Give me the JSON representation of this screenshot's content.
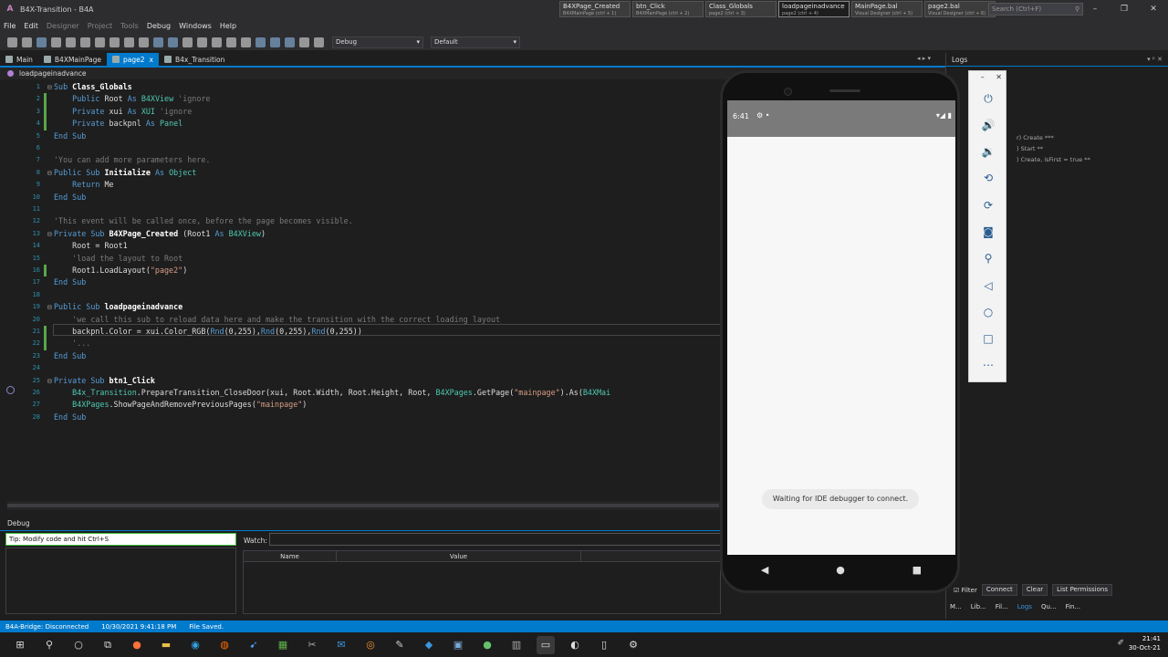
{
  "window": {
    "title": "B4X-Transition - B4A",
    "controls": [
      "–",
      "❐",
      "✕"
    ]
  },
  "quick_tabs": [
    {
      "name": "B4XPage_Created",
      "sub": "B4XMainPage  (ctrl + 1)",
      "active": false
    },
    {
      "name": "btn_Click",
      "sub": "B4XMainPage  (ctrl + 2)",
      "active": false
    },
    {
      "name": "Class_Globals",
      "sub": "page2  (ctrl + 3)",
      "active": false
    },
    {
      "name": "loadpageinadvance",
      "sub": "page2  (ctrl + 4)",
      "active": true
    },
    {
      "name": "MainPage.bal",
      "sub": "Visual Designer  (ctrl + 5)",
      "active": false
    },
    {
      "name": "page2.bal",
      "sub": "Visual Designer  (ctrl + 6)",
      "active": false
    }
  ],
  "search": {
    "placeholder": "Search (Ctrl+F)"
  },
  "menu": [
    "File",
    "Edit",
    "Designer",
    "Project",
    "Tools",
    "Debug",
    "Windows",
    "Help"
  ],
  "toolbar": {
    "build_config": "Debug",
    "build_target": "Default"
  },
  "doc_tabs": [
    {
      "label": "Main",
      "active": false
    },
    {
      "label": "B4XMainPage",
      "active": false
    },
    {
      "label": "page2",
      "active": true,
      "close": "x"
    },
    {
      "label": "B4x_Transition",
      "active": false
    }
  ],
  "breadcrumb": "loadpageinadvance",
  "code": [
    {
      "n": "1",
      "fold": "⊟",
      "tokens": [
        [
          "kw",
          "Sub "
        ],
        [
          "bd",
          "Class_Globals"
        ]
      ]
    },
    {
      "n": "2",
      "tokens": [
        [
          "pl",
          "    "
        ],
        [
          "kw",
          "Public "
        ],
        [
          "pl",
          "Root "
        ],
        [
          "kw",
          "As "
        ],
        [
          "ty",
          "B4XView "
        ],
        [
          "cm",
          "'ignore"
        ]
      ]
    },
    {
      "n": "3",
      "tokens": [
        [
          "pl",
          "    "
        ],
        [
          "kw",
          "Private "
        ],
        [
          "pl",
          "xui "
        ],
        [
          "kw",
          "As "
        ],
        [
          "ty",
          "XUI "
        ],
        [
          "cm",
          "'ignore"
        ]
      ]
    },
    {
      "n": "4",
      "tokens": [
        [
          "pl",
          "    "
        ],
        [
          "kw",
          "Private "
        ],
        [
          "pl",
          "backpnl "
        ],
        [
          "kw",
          "As "
        ],
        [
          "ty",
          "Panel"
        ]
      ]
    },
    {
      "n": "5",
      "tokens": [
        [
          "kw",
          "End Sub"
        ]
      ]
    },
    {
      "n": "6",
      "tokens": []
    },
    {
      "n": "7",
      "tokens": [
        [
          "cm",
          "'You can add more parameters here."
        ]
      ]
    },
    {
      "n": "8",
      "fold": "⊟",
      "tokens": [
        [
          "kw",
          "Public Sub "
        ],
        [
          "bd",
          "Initialize "
        ],
        [
          "kw",
          "As "
        ],
        [
          "ty",
          "Object"
        ]
      ]
    },
    {
      "n": "9",
      "tokens": [
        [
          "pl",
          "    "
        ],
        [
          "kw",
          "Return "
        ],
        [
          "pl",
          "Me"
        ]
      ]
    },
    {
      "n": "10",
      "tokens": [
        [
          "kw",
          "End Sub"
        ]
      ]
    },
    {
      "n": "11",
      "tokens": []
    },
    {
      "n": "12",
      "tokens": [
        [
          "cm",
          "'This event will be called once, before the page becomes visible."
        ]
      ]
    },
    {
      "n": "13",
      "fold": "⊟",
      "tokens": [
        [
          "kw",
          "Private Sub "
        ],
        [
          "bd",
          "B4XPage_Created "
        ],
        [
          "pl",
          "(Root1 "
        ],
        [
          "kw",
          "As "
        ],
        [
          "ty",
          "B4XView"
        ],
        [
          "pl",
          ")"
        ]
      ]
    },
    {
      "n": "14",
      "tokens": [
        [
          "pl",
          "    Root = Root1"
        ]
      ]
    },
    {
      "n": "15",
      "tokens": [
        [
          "pl",
          "    "
        ],
        [
          "cm",
          "'load the layout to Root"
        ]
      ]
    },
    {
      "n": "16",
      "tokens": [
        [
          "pl",
          "    Root1.LoadLayout("
        ],
        [
          "str",
          "\"page2\""
        ],
        [
          "pl",
          ")"
        ]
      ]
    },
    {
      "n": "17",
      "tokens": [
        [
          "kw",
          "End Sub"
        ]
      ]
    },
    {
      "n": "18",
      "tokens": []
    },
    {
      "n": "19",
      "fold": "⊟",
      "tokens": [
        [
          "kw",
          "Public Sub "
        ],
        [
          "bd",
          "loadpageinadvance"
        ]
      ]
    },
    {
      "n": "20",
      "tokens": [
        [
          "pl",
          "    "
        ],
        [
          "cm",
          "'we call this sub to reload data here and make the transition with the correct loading layout"
        ]
      ]
    },
    {
      "n": "21",
      "tokens": [
        [
          "pl",
          "    backpnl.Color = xui.Color_RGB("
        ],
        [
          "kw",
          "Rnd"
        ],
        [
          "pl",
          "(0,255),"
        ],
        [
          "kw",
          "Rnd"
        ],
        [
          "pl",
          "(0,255),"
        ],
        [
          "kw",
          "Rnd"
        ],
        [
          "pl",
          "(0,255))"
        ]
      ]
    },
    {
      "n": "22",
      "tokens": [
        [
          "pl",
          "    "
        ],
        [
          "cm",
          "'..."
        ]
      ]
    },
    {
      "n": "23",
      "tokens": [
        [
          "kw",
          "End Sub"
        ]
      ]
    },
    {
      "n": "24",
      "tokens": []
    },
    {
      "n": "25",
      "fold": "⊟",
      "tokens": [
        [
          "kw",
          "Private Sub "
        ],
        [
          "bd",
          "btn1_Click"
        ]
      ]
    },
    {
      "n": "26",
      "tokens": [
        [
          "pl",
          "    "
        ],
        [
          "ty",
          "B4x_Transition"
        ],
        [
          "pl",
          ".PrepareTransition_CloseDoor(xui, Root.Width, Root.Height, Root, "
        ],
        [
          "ty",
          "B4XPages"
        ],
        [
          "pl",
          ".GetPage("
        ],
        [
          "str",
          "\"mainpage\""
        ],
        [
          "pl",
          ").As("
        ],
        [
          "ty",
          "B4XMai"
        ]
      ]
    },
    {
      "n": "27",
      "tokens": [
        [
          "pl",
          "    "
        ],
        [
          "ty",
          "B4XPages"
        ],
        [
          "pl",
          ".ShowPageAndRemovePreviousPages("
        ],
        [
          "str",
          "\"mainpage\""
        ],
        [
          "pl",
          ")"
        ]
      ]
    },
    {
      "n": "28",
      "tokens": [
        [
          "kw",
          "End Sub"
        ]
      ]
    }
  ],
  "debug_panel": {
    "title": "Debug",
    "tip": "Tip: Modify code and hit Ctrl+S",
    "watch_label": "Watch:",
    "col_name": "Name",
    "col_value": "Value"
  },
  "logs_panel": {
    "title": "Logs",
    "header_icons": "▾ ᵖ ✕",
    "lines": [
      "r) Create ***",
      ") Start **",
      ") Create, isFirst = true **"
    ],
    "filter_label": "Filter",
    "buttons": [
      "Connect",
      "Clear",
      "List Permissions"
    ],
    "bottom_tabs": [
      "M...",
      "Lib...",
      "Fil...",
      "Logs",
      "Qu...",
      "Fin..."
    ]
  },
  "emulator_side": {
    "header": [
      "–",
      "✕"
    ],
    "icons": [
      "power-icon",
      "volume-up-icon",
      "volume-down-icon",
      "rotate-left-icon",
      "rotate-right-icon",
      "camera-icon",
      "zoom-icon",
      "back-icon",
      "home-icon",
      "overview-icon",
      "more-icon"
    ]
  },
  "phone": {
    "time": "6:41",
    "status_icons_left": "⚙ •",
    "status_icons_right": "▾◢ ▮",
    "toast": "Waiting for IDE debugger to connect.",
    "nav": [
      "◀",
      "●",
      "■"
    ]
  },
  "ide_status": {
    "bridge": "B4A-Bridge: Disconnected",
    "time": "10/30/2021 9:41:18 PM",
    "message": "File Saved."
  },
  "taskbar": {
    "clock_time": "21:41",
    "clock_date": "30-Oct-21"
  },
  "colors": {
    "accent": "#007acc",
    "tip_border": "#40c040",
    "status": "#007acc"
  }
}
